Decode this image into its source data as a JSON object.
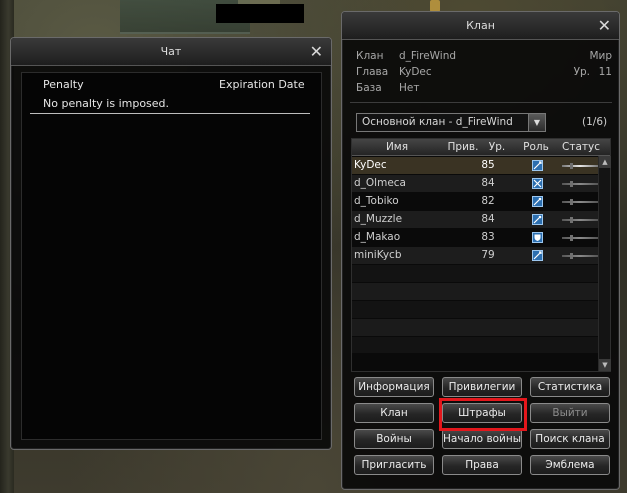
{
  "chat_window": {
    "title": "Чат",
    "close_glyph": "✕",
    "columns": [
      "Penalty",
      "Expiration Date"
    ],
    "message": "No penalty is imposed."
  },
  "clan_window": {
    "title": "Клан",
    "close_glyph": "✕",
    "info": {
      "clan_label": "Клан",
      "clan_value": "d_FireWind",
      "leader_label": "Глава",
      "leader_value": "KyDec",
      "base_label": "База",
      "base_value": "Нет",
      "world_label": "Мир",
      "level_label": "Ур.",
      "level_value": "11"
    },
    "subclan_select": "Основной клан - d_FireWind",
    "member_count": "(1/6)",
    "columns": [
      "Имя",
      "Прив.",
      "Ур.",
      "Роль",
      "Статус"
    ],
    "members": [
      {
        "name": "KyDec",
        "level": "85",
        "role_icon": "sword-role-icon",
        "selected": true
      },
      {
        "name": "d_Olmeca",
        "level": "84",
        "role_icon": "cross-swords-role-icon",
        "selected": false
      },
      {
        "name": "d_Tobiko",
        "level": "82",
        "role_icon": "wand-role-icon",
        "selected": false
      },
      {
        "name": "d_Muzzle",
        "level": "84",
        "role_icon": "wand-role-icon",
        "selected": false
      },
      {
        "name": "d_Makao",
        "level": "83",
        "role_icon": "shield-role-icon",
        "selected": false
      },
      {
        "name": "miniKycb",
        "level": "79",
        "role_icon": "sword-role-icon",
        "selected": false
      }
    ],
    "buttons": {
      "info": "Информация",
      "privileges": "Привилегии",
      "statistics": "Статистика",
      "clan": "Клан",
      "penalties": "Штрафы",
      "leave": "Выйти",
      "wars": "Войны",
      "start_war": "Начало войны",
      "clan_search": "Поиск клана",
      "invite": "Пригласить",
      "rights": "Права",
      "emblem": "Эмблема"
    },
    "highlight_color": "#e3171c"
  }
}
